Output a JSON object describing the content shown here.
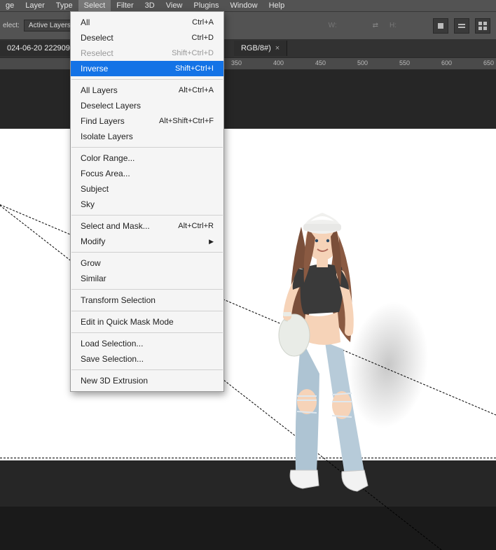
{
  "menubar": {
    "items": [
      "ge",
      "Layer",
      "Type",
      "Select",
      "Filter",
      "3D",
      "View",
      "Plugins",
      "Window",
      "Help"
    ],
    "active_index": 3
  },
  "optionsbar": {
    "select_label": "elect:",
    "select_combo": "Active Layers",
    "w_label": "W:",
    "h_label": "H:",
    "link_icon": "link-icon"
  },
  "document_tab": {
    "title": "024-06-20 222909.",
    "mode_suffix": "RGB/8#)",
    "close": "×"
  },
  "ruler": {
    "ticks": [
      "350",
      "400",
      "450",
      "500",
      "550",
      "600",
      "650"
    ]
  },
  "dropdown": {
    "groups": [
      [
        {
          "label": "All",
          "shortcut": "Ctrl+A"
        },
        {
          "label": "Deselect",
          "shortcut": "Ctrl+D"
        },
        {
          "label": "Reselect",
          "shortcut": "Shift+Ctrl+D",
          "disabled": true
        },
        {
          "label": "Inverse",
          "shortcut": "Shift+Ctrl+I",
          "highlight": true
        }
      ],
      [
        {
          "label": "All Layers",
          "shortcut": "Alt+Ctrl+A"
        },
        {
          "label": "Deselect Layers"
        },
        {
          "label": "Find Layers",
          "shortcut": "Alt+Shift+Ctrl+F"
        },
        {
          "label": "Isolate Layers"
        }
      ],
      [
        {
          "label": "Color Range..."
        },
        {
          "label": "Focus Area..."
        },
        {
          "label": "Subject"
        },
        {
          "label": "Sky"
        }
      ],
      [
        {
          "label": "Select and Mask...",
          "shortcut": "Alt+Ctrl+R"
        },
        {
          "label": "Modify",
          "submenu": true
        }
      ],
      [
        {
          "label": "Grow"
        },
        {
          "label": "Similar"
        }
      ],
      [
        {
          "label": "Transform Selection"
        }
      ],
      [
        {
          "label": "Edit in Quick Mask Mode"
        }
      ],
      [
        {
          "label": "Load Selection..."
        },
        {
          "label": "Save Selection..."
        }
      ],
      [
        {
          "label": "New 3D Extrusion"
        }
      ]
    ]
  },
  "illustration": {
    "desc": "girl-with-beanie-ripped-jeans",
    "colors": {
      "skin": "#f6d3b8",
      "hair": "#7a4f3a",
      "beanie": "#f0f0ee",
      "top": "#3a3a3a",
      "jeans": "#aec4d3",
      "shoes": "#f2f2f2",
      "bag": "#e9ece7"
    }
  }
}
